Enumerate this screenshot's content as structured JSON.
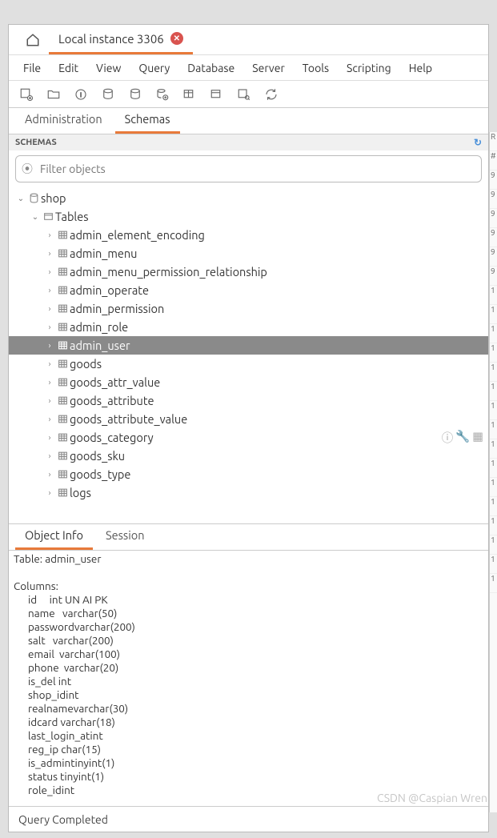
{
  "tabs": {
    "connection_name": "Local instance 3306"
  },
  "menu": [
    "File",
    "Edit",
    "View",
    "Query",
    "Database",
    "Server",
    "Tools",
    "Scripting",
    "Help"
  ],
  "nav_tabs": {
    "admin": "Administration",
    "schemas": "Schemas"
  },
  "schemas_header": "SCHEMAS",
  "filter_placeholder": "Filter objects",
  "tree": {
    "db": "shop",
    "tables_label": "Tables",
    "tables": [
      "admin_element_encoding",
      "admin_menu",
      "admin_menu_permission_relationship",
      "admin_operate",
      "admin_permission",
      "admin_role",
      "admin_user",
      "goods",
      "goods_attr_value",
      "goods_attribute",
      "goods_attribute_value",
      "goods_category",
      "goods_sku",
      "goods_type",
      "logs"
    ],
    "selected": "admin_user",
    "hover_actions_on": "goods_category"
  },
  "info_tabs": {
    "object": "Object Info",
    "session": "Session"
  },
  "object_info": {
    "title": "Table: admin_user",
    "columns_label": "Columns:",
    "columns": [
      [
        "id",
        "int UN AI PK"
      ],
      [
        "name",
        "varchar(50)"
      ],
      [
        "password",
        "varchar(200)"
      ],
      [
        "salt",
        "varchar(200)"
      ],
      [
        "email",
        "varchar(100)"
      ],
      [
        "phone",
        "varchar(20)"
      ],
      [
        "is_del",
        "int"
      ],
      [
        "shop_id",
        "int"
      ],
      [
        "realname",
        "varchar(30)"
      ],
      [
        "idcard",
        "varchar(18)"
      ],
      [
        "last_login_at",
        "int"
      ],
      [
        "reg_ip",
        "char(15)"
      ],
      [
        "is_admin",
        "tinyint(1)"
      ],
      [
        "status",
        "tinyint(1)"
      ],
      [
        "role_id",
        "int"
      ]
    ]
  },
  "status_bar": "Query Completed",
  "watermark": "CSDN @Caspian Wren",
  "right_sliver": [
    "R",
    "#",
    "9",
    "9",
    "9",
    "9",
    "9",
    "9",
    "1",
    "1",
    "1",
    "1",
    "1",
    "1",
    "1",
    "1",
    "1",
    "1",
    "1",
    "1",
    "1",
    "1",
    "1",
    "1"
  ]
}
